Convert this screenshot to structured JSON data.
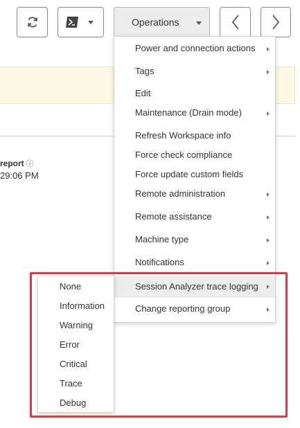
{
  "toolbar": {
    "operations_label": "Operations"
  },
  "background": {
    "report_label": "report",
    "report_time": "29:06 PM"
  },
  "menu": {
    "items": [
      {
        "label": "Power and connection actions",
        "has_submenu": true
      },
      {
        "label": "Tags",
        "has_submenu": true
      },
      {
        "label": "Edit",
        "has_submenu": false
      },
      {
        "label": "Maintenance (Drain mode)",
        "has_submenu": true
      },
      {
        "label": "Refresh Workspace info",
        "has_submenu": false
      },
      {
        "label": "Force check compliance",
        "has_submenu": false
      },
      {
        "label": "Force update custom fields",
        "has_submenu": false
      },
      {
        "label": "Remote administration",
        "has_submenu": true
      },
      {
        "label": "Remote assistance",
        "has_submenu": true
      },
      {
        "label": "Machine type",
        "has_submenu": true
      },
      {
        "label": "Notifications",
        "has_submenu": true
      },
      {
        "label": "Session Analyzer trace logging",
        "has_submenu": true,
        "active": true
      },
      {
        "label": "Change reporting group",
        "has_submenu": true
      }
    ]
  },
  "submenu": {
    "items": [
      "None",
      "Information",
      "Warning",
      "Error",
      "Critical",
      "Trace",
      "Debug"
    ]
  },
  "colors": {
    "highlight": "#e0383e",
    "active_item_bg": "#ececec",
    "banner_bg": "#fdf8e4"
  }
}
